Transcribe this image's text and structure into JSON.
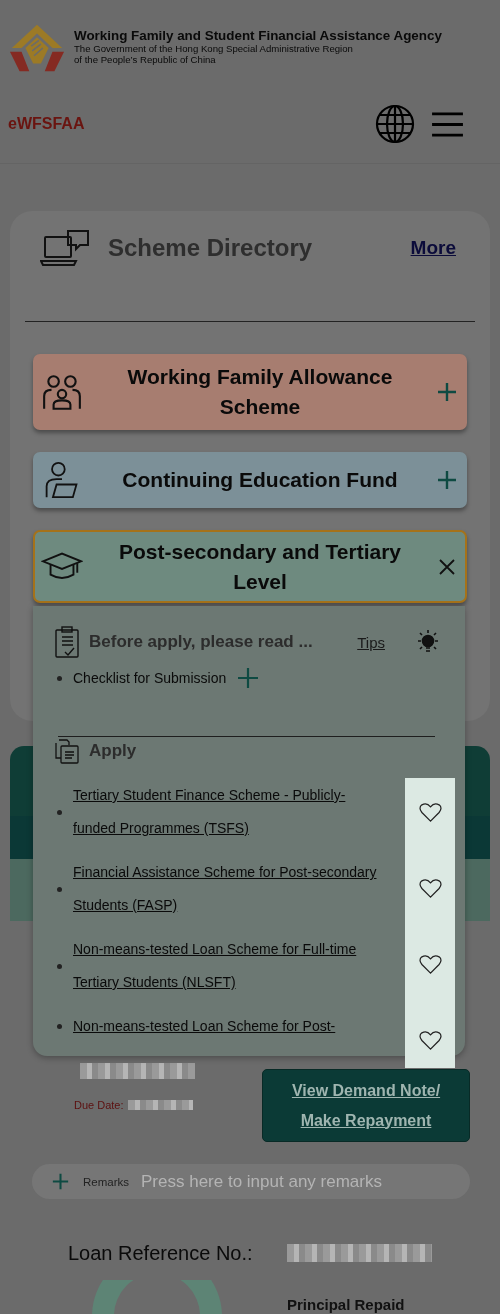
{
  "header": {
    "agency_name": "Working Family and Student Financial Assistance Agency",
    "subtitle_lines": [
      "The Government of the Hong Kong Special Administrative Region",
      "of the People’s Republic of China"
    ]
  },
  "nav": {
    "brand": "eWFSFAA"
  },
  "scheme_directory": {
    "title": "Scheme Directory",
    "more_link": "More",
    "schemes": [
      {
        "label": "Working Family Allowance Scheme",
        "color": "#a77d70",
        "expanded": false
      },
      {
        "label": "Continuing Education Fund",
        "color": "#7c9098",
        "expanded": false
      },
      {
        "label": "Post-secondary and Tertiary Level",
        "color": "#6e8a7f",
        "expanded": true
      }
    ]
  },
  "panel": {
    "notice_title": "Before apply, please read ...",
    "tips_link": "Tips",
    "checklist": [
      {
        "label": "Checklist for Submission",
        "expanded": false
      }
    ],
    "apply_title": "Apply",
    "apply_links": [
      {
        "label": "Tertiary Student Finance Scheme - Publicly-funded Programmes (TSFS)",
        "favourite": false
      },
      {
        "label": "Financial Assistance Scheme for Post-secondary Students (FASP)",
        "favourite": false
      },
      {
        "label": "Non-means-tested Loan Scheme for Full-time Tertiary Students (NLSFT)",
        "favourite": false
      },
      {
        "label": "Non-means-tested Loan Scheme for Post-",
        "favourite": false
      }
    ]
  },
  "repayment": {
    "due_date_label": "Due Date:",
    "button": "View Demand Note/ Make Repayment"
  },
  "remarks": {
    "label": "Remarks",
    "placeholder": "Press here to input any remarks",
    "expanded": false
  },
  "loan": {
    "reference_label": "Loan Reference No.:",
    "principal_label": "Principal Repaid"
  }
}
